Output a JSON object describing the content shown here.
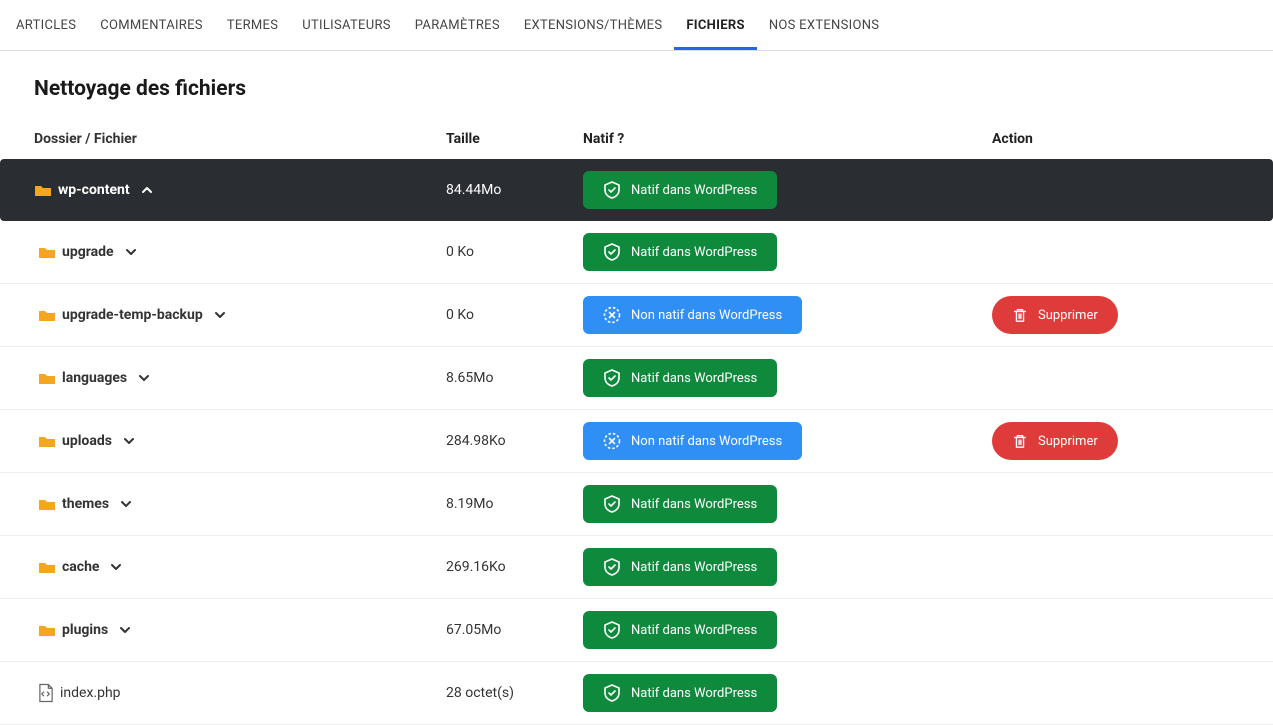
{
  "tabs": [
    {
      "label": "ARTICLES",
      "active": false
    },
    {
      "label": "COMMENTAIRES",
      "active": false
    },
    {
      "label": "TERMES",
      "active": false
    },
    {
      "label": "UTILISATEURS",
      "active": false
    },
    {
      "label": "PARAMÈTRES",
      "active": false
    },
    {
      "label": "EXTENSIONS/THÈMES",
      "active": false
    },
    {
      "label": "FICHIERS",
      "active": true
    },
    {
      "label": "NOS EXTENSIONS",
      "active": false
    }
  ],
  "page_title": "Nettoyage des fichiers",
  "columns": {
    "name": "Dossier / Fichier",
    "size": "Taille",
    "native": "Natif ?",
    "action": "Action"
  },
  "badge_text": {
    "native": "Natif dans WordPress",
    "not_native": "Non natif dans WordPress"
  },
  "delete_label": "Supprimer",
  "rows": [
    {
      "type": "folder",
      "name": "wp-content",
      "size": "84.44Mo",
      "native": true,
      "expanded": true,
      "deletable": false,
      "indent": 0
    },
    {
      "type": "folder",
      "name": "upgrade",
      "size": "0 Ko",
      "native": true,
      "expanded": false,
      "deletable": false,
      "indent": 1
    },
    {
      "type": "folder",
      "name": "upgrade-temp-backup",
      "size": "0 Ko",
      "native": false,
      "expanded": false,
      "deletable": true,
      "indent": 1
    },
    {
      "type": "folder",
      "name": "languages",
      "size": "8.65Mo",
      "native": true,
      "expanded": false,
      "deletable": false,
      "indent": 1
    },
    {
      "type": "folder",
      "name": "uploads",
      "size": "284.98Ko",
      "native": false,
      "expanded": false,
      "deletable": true,
      "indent": 1
    },
    {
      "type": "folder",
      "name": "themes",
      "size": "8.19Mo",
      "native": true,
      "expanded": false,
      "deletable": false,
      "indent": 1
    },
    {
      "type": "folder",
      "name": "cache",
      "size": "269.16Ko",
      "native": true,
      "expanded": false,
      "deletable": false,
      "indent": 1
    },
    {
      "type": "folder",
      "name": "plugins",
      "size": "67.05Mo",
      "native": true,
      "expanded": false,
      "deletable": false,
      "indent": 1
    },
    {
      "type": "file",
      "name": "index.php",
      "size": "28 octet(s)",
      "native": true,
      "expanded": false,
      "deletable": false,
      "indent": 1
    }
  ]
}
